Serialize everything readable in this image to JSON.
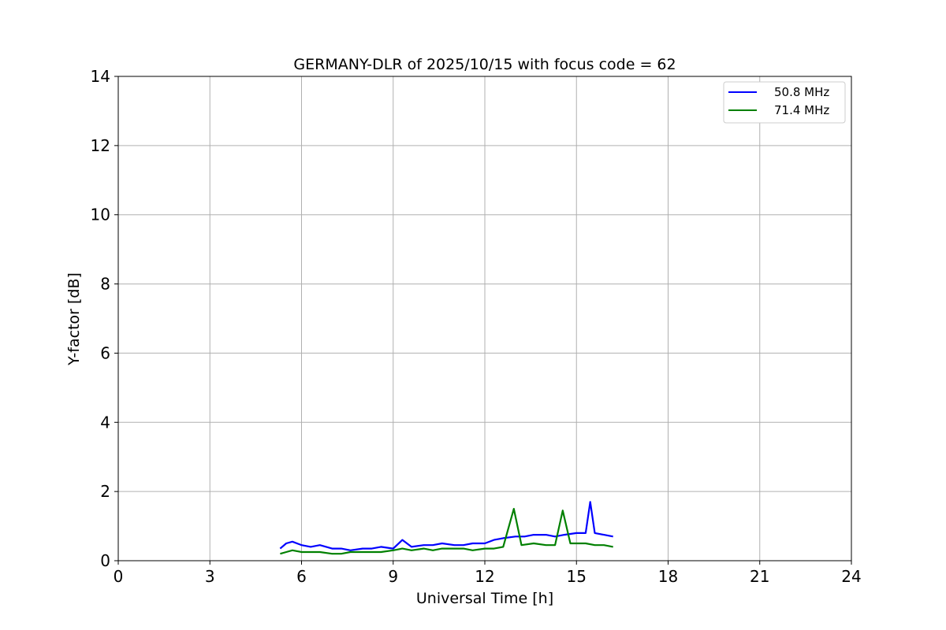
{
  "chart_data": {
    "type": "line",
    "title": "GERMANY-DLR of 2025/10/15 with focus code = 62",
    "xlabel": "Universal Time [h]",
    "ylabel": "Y-factor [dB]",
    "xlim": [
      0,
      24
    ],
    "ylim": [
      0,
      14
    ],
    "xticks": [
      0,
      3,
      6,
      9,
      12,
      15,
      18,
      21,
      24
    ],
    "yticks": [
      0,
      2,
      4,
      6,
      8,
      10,
      12,
      14
    ],
    "grid": true,
    "legend_position": "top-right",
    "series": [
      {
        "name": "50.8 MHz",
        "color": "#0000ff",
        "x": [
          5.3,
          5.5,
          5.7,
          6.0,
          6.3,
          6.6,
          7.0,
          7.3,
          7.6,
          8.0,
          8.3,
          8.6,
          9.0,
          9.3,
          9.6,
          10.0,
          10.3,
          10.6,
          11.0,
          11.3,
          11.6,
          12.0,
          12.3,
          12.6,
          13.0,
          13.3,
          13.6,
          14.0,
          14.3,
          14.6,
          15.0,
          15.3,
          15.45,
          15.6,
          15.9,
          16.2
        ],
        "y": [
          0.35,
          0.5,
          0.55,
          0.45,
          0.4,
          0.45,
          0.35,
          0.35,
          0.3,
          0.35,
          0.35,
          0.4,
          0.35,
          0.6,
          0.4,
          0.45,
          0.45,
          0.5,
          0.45,
          0.45,
          0.5,
          0.5,
          0.6,
          0.65,
          0.7,
          0.7,
          0.75,
          0.75,
          0.7,
          0.75,
          0.8,
          0.8,
          1.7,
          0.8,
          0.75,
          0.7
        ]
      },
      {
        "name": "71.4 MHz",
        "color": "#008000",
        "x": [
          5.3,
          5.5,
          5.7,
          6.0,
          6.3,
          6.6,
          7.0,
          7.3,
          7.6,
          8.0,
          8.3,
          8.6,
          9.0,
          9.3,
          9.6,
          10.0,
          10.3,
          10.6,
          11.0,
          11.3,
          11.6,
          12.0,
          12.3,
          12.6,
          12.95,
          13.2,
          13.6,
          14.0,
          14.3,
          14.55,
          14.8,
          15.0,
          15.3,
          15.6,
          15.9,
          16.2
        ],
        "y": [
          0.2,
          0.25,
          0.3,
          0.25,
          0.25,
          0.25,
          0.2,
          0.2,
          0.25,
          0.25,
          0.25,
          0.25,
          0.3,
          0.35,
          0.3,
          0.35,
          0.3,
          0.35,
          0.35,
          0.35,
          0.3,
          0.35,
          0.35,
          0.4,
          1.5,
          0.45,
          0.5,
          0.45,
          0.45,
          1.45,
          0.5,
          0.5,
          0.5,
          0.45,
          0.45,
          0.4
        ]
      }
    ]
  }
}
